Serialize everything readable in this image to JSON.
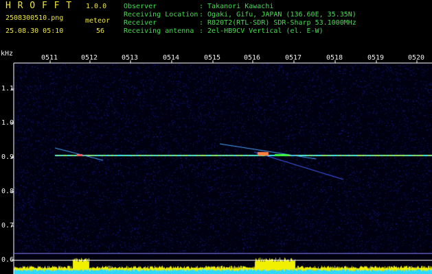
{
  "app": {
    "title": "H R O F F T",
    "version": "1.0.0"
  },
  "header": {
    "filename": "2508300510.png",
    "datetime": "25.08.30 05:10",
    "meteor_label": "meteor",
    "meteor_count": "56",
    "info": [
      {
        "label": "Observer",
        "value": ": Takanori Kawachi"
      },
      {
        "label": "Receiving Location",
        "value": ": Ogaki, Gifu, JAPAN (136.60E, 35.35N)"
      },
      {
        "label": "Receiver",
        "value": ": R820T2(RTL-SDR) SDR-Sharp 53.1000MHz"
      },
      {
        "label": "Receiving antenna",
        "value": ": 2el-HB9CV Vertical (el. E-W)"
      }
    ]
  },
  "axis": {
    "unit": "kHz",
    "y_ticks": [
      "1.1",
      "1.0",
      "0.9",
      "0.8",
      "0.7",
      "0.6"
    ],
    "x_ticks": [
      "0511",
      "0512",
      "0513",
      "0514",
      "0515",
      "0516",
      "0517",
      "0518",
      "0519",
      "0520"
    ]
  },
  "colors": {
    "background": "#000000",
    "header_text": "#3fe04a",
    "title_text": "#f0e832",
    "noise": "#1a2a9a",
    "carrier": "#3cf0ff",
    "burst": "#ff5050",
    "activity": "#f0f000",
    "baseline": "#30d8ff"
  }
}
